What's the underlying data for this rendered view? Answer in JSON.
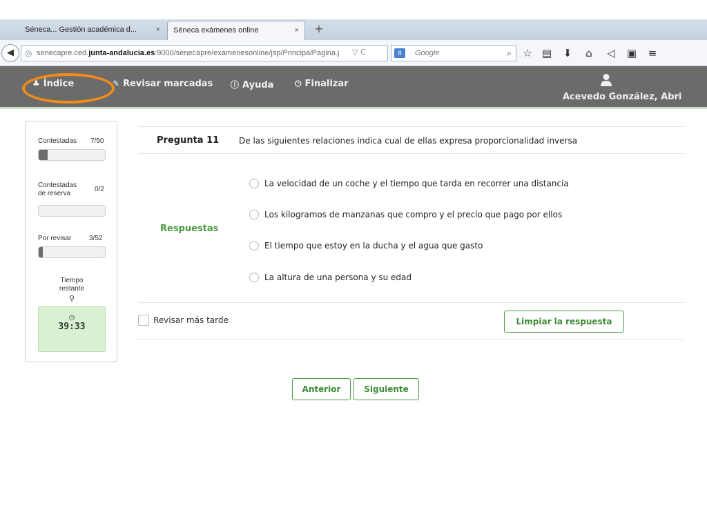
{
  "browser": {
    "tabs": [
      {
        "title": "Séneca... Gestión académica d...",
        "close": "×"
      },
      {
        "title": "Séneca exámenes online",
        "close": "×"
      }
    ],
    "new_tab": "+",
    "url": {
      "prefix": "senecapre.ced.",
      "strong": "junta-andalucia.es",
      "rest": ":9000/senecapre/examenesonline/jsp/PrincipalPagina.j"
    },
    "url_actions": "▽ C",
    "search": {
      "placeholder": "Google",
      "engine": "8"
    }
  },
  "app_menu": {
    "indice": "Índice",
    "revisar": "Revisar marcadas",
    "ayuda": "Ayuda",
    "finalizar": "Finalizar"
  },
  "user": {
    "name": "Acevedo González, Abri"
  },
  "status": {
    "contestadas_label": "Contestadas",
    "contestadas_value": "7/50",
    "contestadas_fraction": 0.14,
    "reserva_label_1": "Contestadas",
    "reserva_label_2": "de reserva",
    "reserva_value": "0/2",
    "reserva_fraction": 0.0,
    "revisar_label": "Por revisar",
    "revisar_value": "3/52",
    "revisar_fraction": 0.06,
    "tiempo_label_1": "Tiempo",
    "tiempo_label_2": "restante",
    "tiempo_value": "39:33"
  },
  "question": {
    "number": "Pregunta 11",
    "text": "De las siguientes relaciones indica cual de ellas expresa proporcionalidad inversa",
    "answers_label": "Respuestas",
    "options": [
      "La velocidad de un coche y el tiempo que tarda en recorrer una distancia",
      "Los kilogramos de manzanas que compro y el precio que pago por ellos",
      "El tiempo que estoy en la ducha y el agua que gasto",
      "La altura de una persona y su edad"
    ],
    "review_later": "Revisar más tarde",
    "clear_button": "Limpiar la respuesta"
  },
  "navigation": {
    "previous": "Anterior",
    "next": "Siguiente"
  }
}
